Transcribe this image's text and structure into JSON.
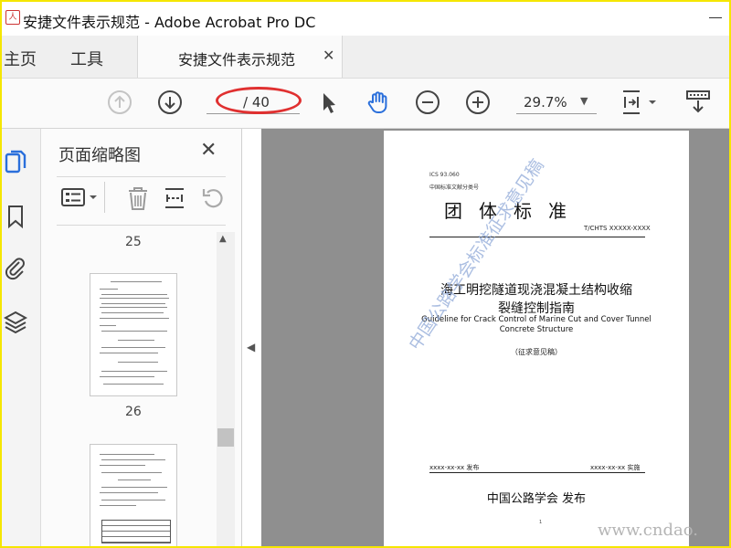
{
  "window": {
    "app_icon_text": "人",
    "title": "安捷文件表示规范 - Adobe Acrobat Pro DC"
  },
  "menu": {
    "home": "主页",
    "tools": "工具",
    "tab_label": "安捷文件表示规范",
    "tab_close": "✕"
  },
  "toolbar": {
    "page_display": "/ 40",
    "zoom": "29.7%",
    "zoom_caret": "▼",
    "icons": [
      "page-up-icon",
      "page-down-icon",
      "select-cursor-icon",
      "hand-tool-icon",
      "zoom-out-icon",
      "zoom-in-icon",
      "fit-page-icon",
      "scroll-mode-icon"
    ],
    "highlight_color": "#e03030",
    "accent_color": "#2a6fdb"
  },
  "left_rail": {
    "icons": [
      "page-thumbnails-icon",
      "bookmark-icon",
      "attachment-icon",
      "layers-icon"
    ]
  },
  "thumbnail_panel": {
    "title": "页面缩略图",
    "close": "✕",
    "page_labels": [
      "25",
      "26"
    ],
    "scroll_up": "▲",
    "collapse_arrow": "◀"
  },
  "document": {
    "ics": "ICS 93.060",
    "classification": "中国标准文献分类号",
    "title": "团体标准",
    "code": "T/CHTS XXXXX-XXXX",
    "name_zh_line1": "海工明挖隧道现浇混凝土结构收缩",
    "name_zh_line2": "裂缝控制指南",
    "name_en_line1": "Guideline for Crack Control of Marine Cut and Cover Tunnel",
    "name_en_line2": "Concrete Structure",
    "status": "（征求意见稿）",
    "issue_date": "xxxx-xx-xx 发布",
    "impl_date": "xxxx-xx-xx 实施",
    "issuer": "中国公路学会  发布",
    "page_no": "1",
    "watermark": "中国公路学会标准征求意见稿"
  },
  "site_watermark": "www.cndao."
}
